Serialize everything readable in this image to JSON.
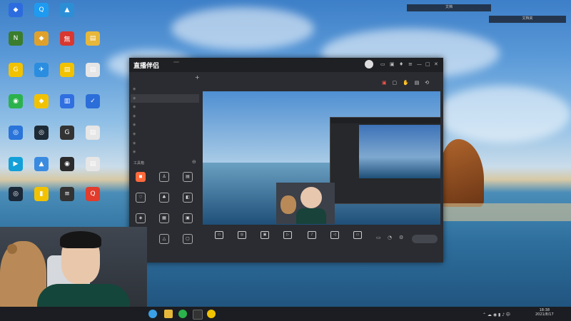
{
  "desktop": {
    "top_boxes": [
      "文档",
      "文档夹"
    ],
    "icons": [
      {
        "label": "",
        "color": "#2d6cdf",
        "glyph": "◆"
      },
      {
        "label": "",
        "color": "#1e9bf0",
        "glyph": "Q"
      },
      {
        "label": "",
        "color": "#2c8fd6",
        "glyph": "▲"
      },
      {
        "label": "",
        "color": "#3a7d2c",
        "glyph": "N"
      },
      {
        "label": "",
        "color": "#e0a12c",
        "glyph": "◆"
      },
      {
        "label": "",
        "color": "#d9372f",
        "glyph": "無"
      },
      {
        "label": "",
        "color": "#e7b73a",
        "glyph": "▤"
      },
      {
        "label": "",
        "color": "#f2c200",
        "glyph": "G"
      },
      {
        "label": "",
        "color": "#2a8de0",
        "glyph": "✈"
      },
      {
        "label": "",
        "color": "#f2c200",
        "glyph": "▤"
      },
      {
        "label": "",
        "color": "#e6e6e6",
        "glyph": "▤"
      },
      {
        "label": "",
        "color": "#2bb24c",
        "glyph": "◉"
      },
      {
        "label": "",
        "color": "#f2c200",
        "glyph": "◆"
      },
      {
        "label": "",
        "color": "#2f6fe0",
        "glyph": "▥"
      },
      {
        "label": "",
        "color": "#2b6ed9",
        "glyph": "✓"
      },
      {
        "label": "",
        "color": "#2a74da",
        "glyph": "◎"
      },
      {
        "label": "",
        "color": "#1d2b36",
        "glyph": "◎"
      },
      {
        "label": "",
        "color": "#333",
        "glyph": "G"
      },
      {
        "label": "",
        "color": "#e6e6e6",
        "glyph": "▤"
      },
      {
        "label": "",
        "color": "#13a0d8",
        "glyph": "▶"
      },
      {
        "label": "",
        "color": "#3a8be0",
        "glyph": "▲"
      },
      {
        "label": "",
        "color": "#2b2b2b",
        "glyph": "◉"
      },
      {
        "label": "",
        "color": "#e6e6e6",
        "glyph": "▤"
      },
      {
        "label": "",
        "color": "#1b2838",
        "glyph": "◎"
      },
      {
        "label": "",
        "color": "#f2c200",
        "glyph": "▮"
      },
      {
        "label": "",
        "color": "#333",
        "glyph": "≡"
      },
      {
        "label": "",
        "color": "#e13c2c",
        "glyph": "Q"
      }
    ]
  },
  "app": {
    "title": "直播伴侣",
    "version_badge": "",
    "tabs": [
      "",
      "",
      "",
      ""
    ],
    "title_line": "",
    "scene_rows": [
      "",
      "",
      "",
      "",
      "",
      "",
      "",
      ""
    ],
    "tools_header": "工具箱",
    "tools": [
      "",
      "",
      "",
      "",
      "",
      "",
      "",
      "",
      "",
      "",
      "",
      ""
    ],
    "bottom_buttons": [
      "",
      "",
      "",
      "",
      "",
      "",
      ""
    ],
    "start_button": "",
    "status_text": "",
    "recommend_text": ""
  },
  "taskbar": {
    "clock_time": "18:38",
    "clock_date": "2021/8/17"
  }
}
